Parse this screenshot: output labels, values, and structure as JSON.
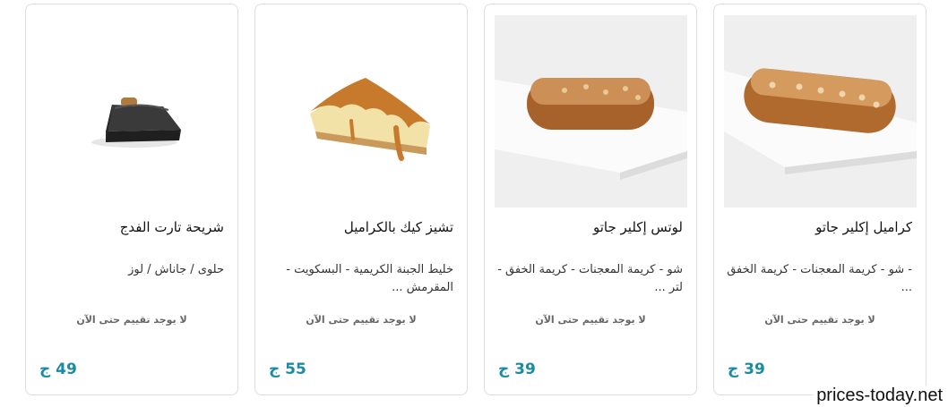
{
  "products": [
    {
      "title": "شريحة تارت الفدج",
      "description": "حلوى / جاناش / لوز",
      "rating_text": "لا يوجد تقييم حتى الآن",
      "price": "49 ج",
      "image": "fudge-tart-slice"
    },
    {
      "title": "تشيز كيك بالكراميل",
      "description": "خليط الجبنة الكريمية - البسكويت - المقرمش ...",
      "rating_text": "لا يوجد تقييم حتى الآن",
      "price": "55 ج",
      "image": "caramel-cheesecake-slice"
    },
    {
      "title": "لوتس إكلير جاتو",
      "description": "شو - كريمة المعجنات - كريمة الخفق - لتر ...",
      "rating_text": "لا يوجد تقييم حتى الآن",
      "price": "39 ج",
      "image": "lotus-eclair"
    },
    {
      "title": "كراميل إكلير جاتو",
      "description": "- شو - كريمة المعجنات - كريمة الخفق ...",
      "rating_text": "لا يوجد تقييم حتى الآن",
      "price": "39 ج",
      "image": "caramel-eclair"
    }
  ],
  "watermark": "prices-today.net",
  "colors": {
    "price": "#1a8ba5",
    "border": "#dedede"
  }
}
